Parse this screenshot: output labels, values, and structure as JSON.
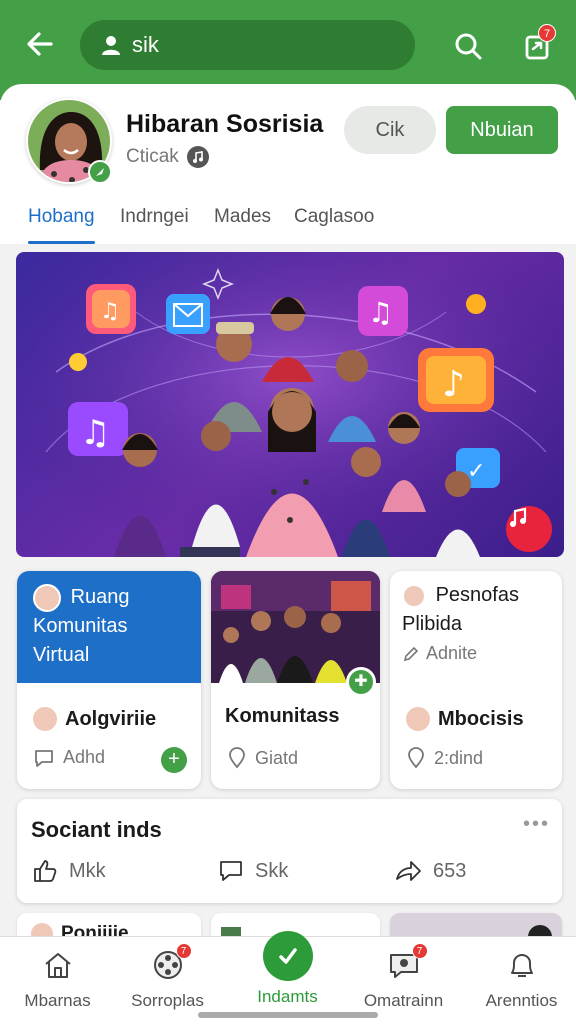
{
  "colors": {
    "brand_green": "#43a047",
    "tab_blue": "#1e6fc8",
    "badge_red": "#e53935"
  },
  "topbar": {
    "search_value": "sik",
    "back_icon": "arrow-left-icon",
    "search_icon": "search-icon",
    "share_icon": "share-icon",
    "notification_badge": "7"
  },
  "profile": {
    "name": "Hibaran Sosrisia",
    "subtitle": "Cticak",
    "secondary_button": "Cik",
    "primary_button": "Nbuian"
  },
  "tabs": [
    {
      "label": "Hobang",
      "active": true
    },
    {
      "label": "Indrngei",
      "active": false
    },
    {
      "label": "Mades",
      "active": false
    },
    {
      "label": "Caglasoo",
      "active": false
    }
  ],
  "cards": [
    {
      "title": "Ruang Komunitas Virtual",
      "name": "Aolgviriie",
      "action": "Adhd"
    },
    {
      "name": "Komunitass",
      "action": "Giatd"
    },
    {
      "title": "Pesnofas Plibida",
      "sub": "Adnite",
      "name": "Mbocisis",
      "action": "2:dind"
    }
  ],
  "social": {
    "title": "Sociant inds",
    "actions": [
      {
        "label": "Mkk",
        "icon": "like-icon"
      },
      {
        "label": "Skk",
        "icon": "comment-icon"
      },
      {
        "label": "653",
        "icon": "share-icon"
      }
    ]
  },
  "peek": {
    "first_title": "Ponjiiie"
  },
  "bottom_nav": [
    {
      "label": "Mbarnas",
      "icon": "home-icon",
      "badge": ""
    },
    {
      "label": "Sorroplas",
      "icon": "film-reel-icon",
      "badge": "7"
    },
    {
      "label": "Indamts",
      "icon": "check-icon",
      "badge": "",
      "active": true
    },
    {
      "label": "Omatrainn",
      "icon": "chat-icon",
      "badge": "7"
    },
    {
      "label": "Arenntios",
      "icon": "bell-icon",
      "badge": ""
    }
  ]
}
